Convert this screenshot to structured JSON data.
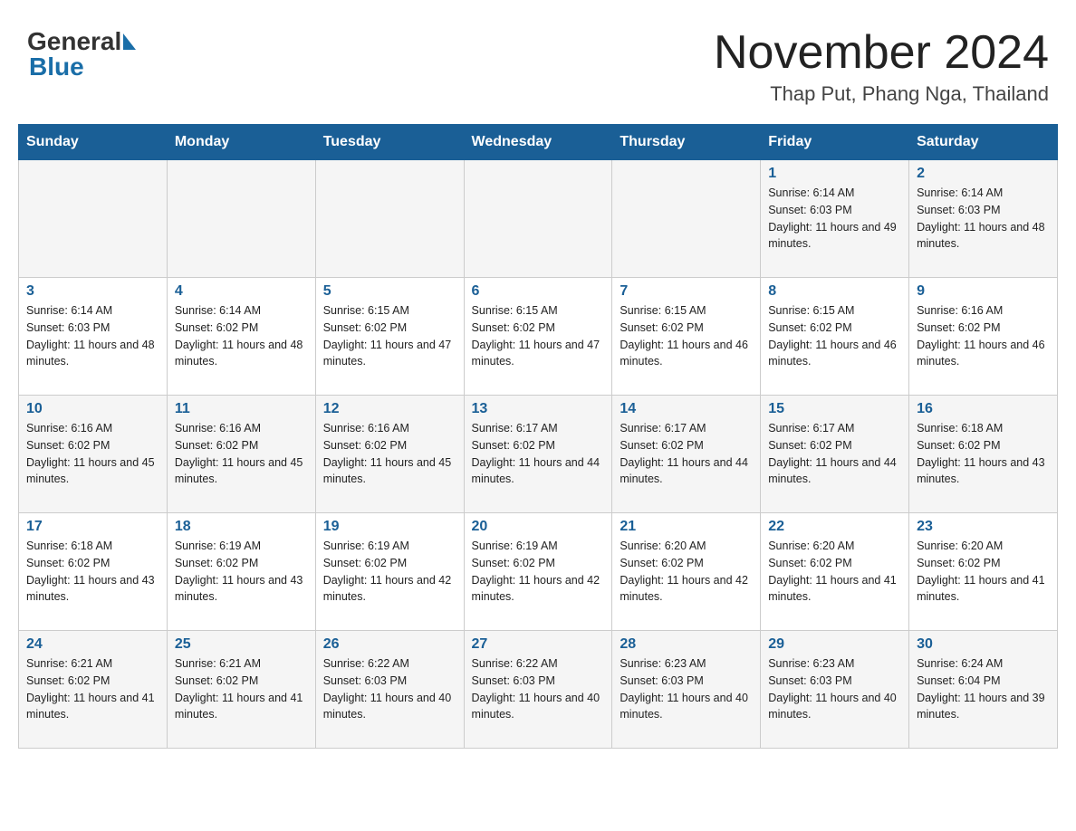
{
  "header": {
    "logo_general": "General",
    "logo_blue": "Blue",
    "month_title": "November 2024",
    "location": "Thap Put, Phang Nga, Thailand"
  },
  "calendar": {
    "days_of_week": [
      "Sunday",
      "Monday",
      "Tuesday",
      "Wednesday",
      "Thursday",
      "Friday",
      "Saturday"
    ],
    "weeks": [
      [
        {
          "day": "",
          "info": ""
        },
        {
          "day": "",
          "info": ""
        },
        {
          "day": "",
          "info": ""
        },
        {
          "day": "",
          "info": ""
        },
        {
          "day": "",
          "info": ""
        },
        {
          "day": "1",
          "info": "Sunrise: 6:14 AM\nSunset: 6:03 PM\nDaylight: 11 hours and 49 minutes."
        },
        {
          "day": "2",
          "info": "Sunrise: 6:14 AM\nSunset: 6:03 PM\nDaylight: 11 hours and 48 minutes."
        }
      ],
      [
        {
          "day": "3",
          "info": "Sunrise: 6:14 AM\nSunset: 6:03 PM\nDaylight: 11 hours and 48 minutes."
        },
        {
          "day": "4",
          "info": "Sunrise: 6:14 AM\nSunset: 6:02 PM\nDaylight: 11 hours and 48 minutes."
        },
        {
          "day": "5",
          "info": "Sunrise: 6:15 AM\nSunset: 6:02 PM\nDaylight: 11 hours and 47 minutes."
        },
        {
          "day": "6",
          "info": "Sunrise: 6:15 AM\nSunset: 6:02 PM\nDaylight: 11 hours and 47 minutes."
        },
        {
          "day": "7",
          "info": "Sunrise: 6:15 AM\nSunset: 6:02 PM\nDaylight: 11 hours and 46 minutes."
        },
        {
          "day": "8",
          "info": "Sunrise: 6:15 AM\nSunset: 6:02 PM\nDaylight: 11 hours and 46 minutes."
        },
        {
          "day": "9",
          "info": "Sunrise: 6:16 AM\nSunset: 6:02 PM\nDaylight: 11 hours and 46 minutes."
        }
      ],
      [
        {
          "day": "10",
          "info": "Sunrise: 6:16 AM\nSunset: 6:02 PM\nDaylight: 11 hours and 45 minutes."
        },
        {
          "day": "11",
          "info": "Sunrise: 6:16 AM\nSunset: 6:02 PM\nDaylight: 11 hours and 45 minutes."
        },
        {
          "day": "12",
          "info": "Sunrise: 6:16 AM\nSunset: 6:02 PM\nDaylight: 11 hours and 45 minutes."
        },
        {
          "day": "13",
          "info": "Sunrise: 6:17 AM\nSunset: 6:02 PM\nDaylight: 11 hours and 44 minutes."
        },
        {
          "day": "14",
          "info": "Sunrise: 6:17 AM\nSunset: 6:02 PM\nDaylight: 11 hours and 44 minutes."
        },
        {
          "day": "15",
          "info": "Sunrise: 6:17 AM\nSunset: 6:02 PM\nDaylight: 11 hours and 44 minutes."
        },
        {
          "day": "16",
          "info": "Sunrise: 6:18 AM\nSunset: 6:02 PM\nDaylight: 11 hours and 43 minutes."
        }
      ],
      [
        {
          "day": "17",
          "info": "Sunrise: 6:18 AM\nSunset: 6:02 PM\nDaylight: 11 hours and 43 minutes."
        },
        {
          "day": "18",
          "info": "Sunrise: 6:19 AM\nSunset: 6:02 PM\nDaylight: 11 hours and 43 minutes."
        },
        {
          "day": "19",
          "info": "Sunrise: 6:19 AM\nSunset: 6:02 PM\nDaylight: 11 hours and 42 minutes."
        },
        {
          "day": "20",
          "info": "Sunrise: 6:19 AM\nSunset: 6:02 PM\nDaylight: 11 hours and 42 minutes."
        },
        {
          "day": "21",
          "info": "Sunrise: 6:20 AM\nSunset: 6:02 PM\nDaylight: 11 hours and 42 minutes."
        },
        {
          "day": "22",
          "info": "Sunrise: 6:20 AM\nSunset: 6:02 PM\nDaylight: 11 hours and 41 minutes."
        },
        {
          "day": "23",
          "info": "Sunrise: 6:20 AM\nSunset: 6:02 PM\nDaylight: 11 hours and 41 minutes."
        }
      ],
      [
        {
          "day": "24",
          "info": "Sunrise: 6:21 AM\nSunset: 6:02 PM\nDaylight: 11 hours and 41 minutes."
        },
        {
          "day": "25",
          "info": "Sunrise: 6:21 AM\nSunset: 6:02 PM\nDaylight: 11 hours and 41 minutes."
        },
        {
          "day": "26",
          "info": "Sunrise: 6:22 AM\nSunset: 6:03 PM\nDaylight: 11 hours and 40 minutes."
        },
        {
          "day": "27",
          "info": "Sunrise: 6:22 AM\nSunset: 6:03 PM\nDaylight: 11 hours and 40 minutes."
        },
        {
          "day": "28",
          "info": "Sunrise: 6:23 AM\nSunset: 6:03 PM\nDaylight: 11 hours and 40 minutes."
        },
        {
          "day": "29",
          "info": "Sunrise: 6:23 AM\nSunset: 6:03 PM\nDaylight: 11 hours and 40 minutes."
        },
        {
          "day": "30",
          "info": "Sunrise: 6:24 AM\nSunset: 6:04 PM\nDaylight: 11 hours and 39 minutes."
        }
      ]
    ]
  }
}
